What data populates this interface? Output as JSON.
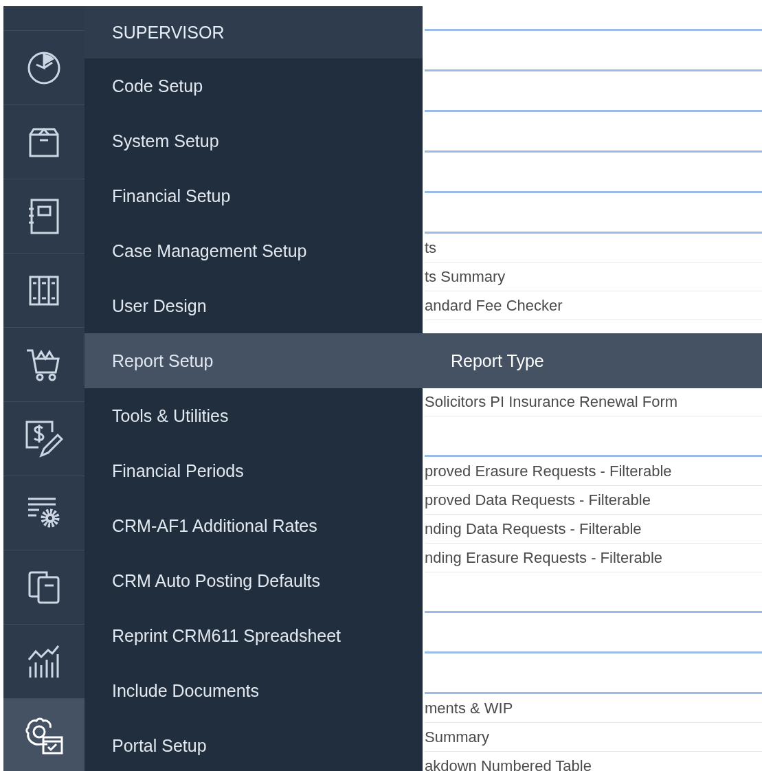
{
  "rail": [
    {
      "selected": false
    },
    {
      "selected": false
    },
    {
      "selected": false
    },
    {
      "selected": false
    },
    {
      "selected": false
    },
    {
      "selected": false
    },
    {
      "selected": false
    },
    {
      "selected": false
    },
    {
      "selected": false
    },
    {
      "selected": true
    }
  ],
  "menu": {
    "title": "SUPERVISOR",
    "items": [
      {
        "label": "Code Setup",
        "selected": false
      },
      {
        "label": "System Setup",
        "selected": false
      },
      {
        "label": "Financial Setup",
        "selected": false
      },
      {
        "label": "Case Management Setup",
        "selected": false
      },
      {
        "label": "User Design",
        "selected": false
      },
      {
        "label": "Report Setup",
        "selected": true,
        "submenu": [
          "Report Type"
        ]
      },
      {
        "label": "Tools & Utilities",
        "selected": false
      },
      {
        "label": "Financial Periods",
        "selected": false
      },
      {
        "label": "CRM-AF1 Additional Rates",
        "selected": false
      },
      {
        "label": "CRM Auto Posting Defaults",
        "selected": false
      },
      {
        "label": "Reprint CRM611 Spreadsheet",
        "selected": false
      },
      {
        "label": "Include Documents",
        "selected": false
      },
      {
        "label": "Portal Setup",
        "selected": false
      }
    ]
  },
  "list": [
    {
      "kind": "gap"
    },
    {
      "kind": "rule"
    },
    {
      "kind": "gap"
    },
    {
      "kind": "rule"
    },
    {
      "kind": "gap"
    },
    {
      "kind": "rule"
    },
    {
      "kind": "gap"
    },
    {
      "kind": "rule"
    },
    {
      "kind": "gap"
    },
    {
      "kind": "rule"
    },
    {
      "kind": "gap"
    },
    {
      "kind": "rule"
    },
    {
      "kind": "row",
      "text": "ts"
    },
    {
      "kind": "row",
      "text": "ts Summary"
    },
    {
      "kind": "row",
      "text": "andard Fee Checker"
    },
    {
      "kind": "blank"
    },
    {
      "kind": "gap"
    },
    {
      "kind": "row",
      "text": "Solicitors PI Insurance Renewal Form"
    },
    {
      "kind": "gap"
    },
    {
      "kind": "rule"
    },
    {
      "kind": "row",
      "text": "proved Erasure Requests - Filterable"
    },
    {
      "kind": "row",
      "text": "proved Data Requests - Filterable"
    },
    {
      "kind": "row",
      "text": "nding Data Requests - Filterable"
    },
    {
      "kind": "row",
      "text": "nding Erasure Requests - Filterable"
    },
    {
      "kind": "gap"
    },
    {
      "kind": "rule"
    },
    {
      "kind": "gap"
    },
    {
      "kind": "rule"
    },
    {
      "kind": "gap"
    },
    {
      "kind": "rule"
    },
    {
      "kind": "row",
      "text": "ments & WIP"
    },
    {
      "kind": "row",
      "text": "Summary"
    },
    {
      "kind": "row",
      "text": "akdown Numbered Table"
    }
  ]
}
